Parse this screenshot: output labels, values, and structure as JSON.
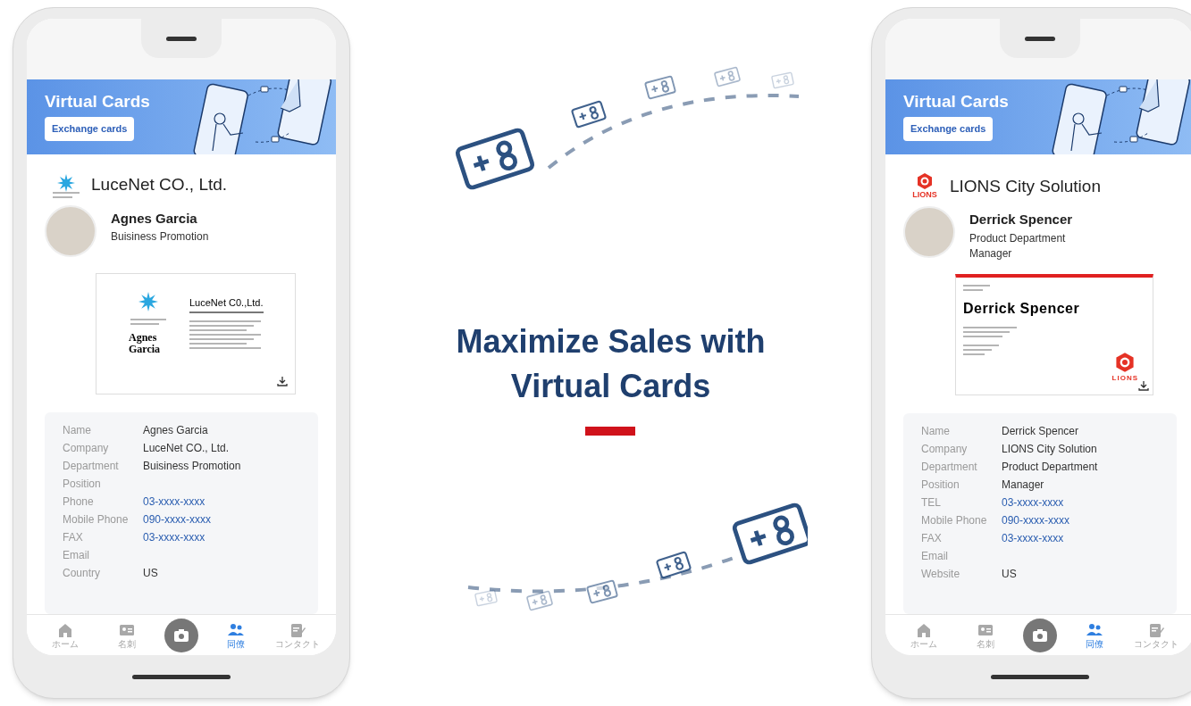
{
  "phones": [
    {
      "banner": {
        "title": "Virtual Cards",
        "button": "Exchange cards"
      },
      "company": {
        "kind": "star",
        "name": "LuceNet CO., Ltd."
      },
      "person": {
        "name": "Agnes Garcia",
        "lines": [
          "Buisiness Promotion"
        ]
      },
      "card": {
        "kind": "lucenet",
        "company": "LuceNet C0.,Ltd.",
        "name": "Agnes Garcia"
      },
      "details": [
        {
          "label": "Name",
          "value": "Agnes Garcia",
          "kind": "text"
        },
        {
          "label": "Company",
          "value": "LuceNet CO., Ltd.",
          "kind": "text"
        },
        {
          "label": "Department",
          "value": "Buisiness Promotion",
          "kind": "text"
        },
        {
          "label": "Position"
        },
        {
          "label": "Phone",
          "value": "03-xxxx-xxxx",
          "kind": "link"
        },
        {
          "label": "Mobile Phone",
          "value": "090-xxxx-xxxx",
          "kind": "link"
        },
        {
          "label": "FAX",
          "value": "03-xxxx-xxxx",
          "kind": "link"
        },
        {
          "label": "Email"
        },
        {
          "label": "Country",
          "value": "US",
          "kind": "text"
        }
      ],
      "nav": [
        {
          "kind": "home",
          "label": "ホーム",
          "selected": false
        },
        {
          "kind": "card",
          "label": "名刺",
          "selected": false
        },
        {
          "kind": "camera",
          "selected": false
        },
        {
          "kind": "people",
          "label": "同僚",
          "selected": true
        },
        {
          "kind": "contact",
          "label": "コンタクト",
          "selected": false
        }
      ]
    },
    {
      "banner": {
        "title": "Virtual Cards",
        "button": "Exchange cards"
      },
      "company": {
        "kind": "lion",
        "logo_text": "LIONS",
        "name": "LIONS City Solution"
      },
      "person": {
        "name": "Derrick Spencer",
        "lines": [
          "Product Department",
          "Manager"
        ]
      },
      "card": {
        "kind": "lions",
        "name": "Derrick Spencer",
        "logo_text": "LIONS"
      },
      "details": [
        {
          "label": "Name",
          "value": "Derrick Spencer",
          "kind": "text"
        },
        {
          "label": "Company",
          "value": "LIONS City Solution",
          "kind": "text"
        },
        {
          "label": "Department",
          "value": "Product Department",
          "kind": "text"
        },
        {
          "label": "Position",
          "value": "Manager",
          "kind": "text"
        },
        {
          "label": "TEL",
          "value": "03-xxxx-xxxx",
          "kind": "link"
        },
        {
          "label": "Mobile Phone",
          "value": "090-xxxx-xxxx",
          "kind": "link"
        },
        {
          "label": "FAX",
          "value": "03-xxxx-xxxx",
          "kind": "link"
        },
        {
          "label": "Email"
        },
        {
          "label": "Website",
          "value": "US",
          "kind": "text"
        }
      ],
      "nav": [
        {
          "kind": "home",
          "label": "ホーム",
          "selected": false
        },
        {
          "kind": "card",
          "label": "名刺",
          "selected": false
        },
        {
          "kind": "camera",
          "selected": false
        },
        {
          "kind": "people",
          "label": "同僚",
          "selected": true
        },
        {
          "kind": "contact",
          "label": "コンタクト",
          "selected": false
        }
      ]
    }
  ],
  "headline": {
    "lines": [
      "Maximize Sales with",
      "Virtual Cards"
    ]
  }
}
